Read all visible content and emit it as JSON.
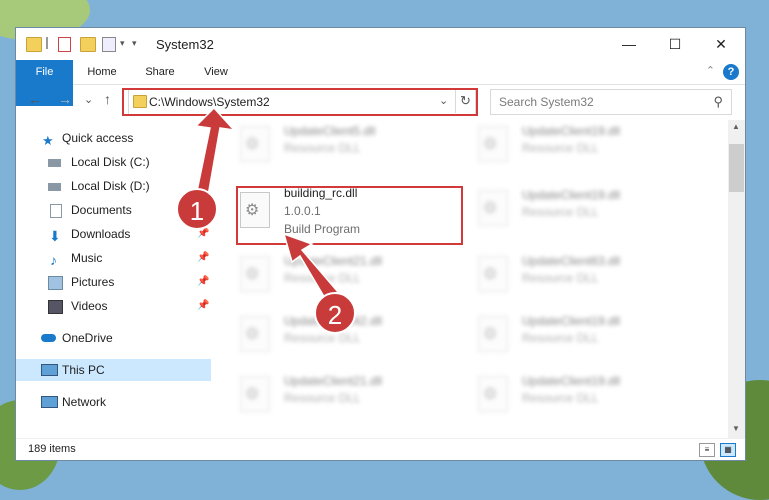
{
  "window": {
    "title": "System32",
    "controls": {
      "minimize": "—",
      "maximize": "☐",
      "close": "✕"
    }
  },
  "ribbon": {
    "tabs": [
      "File",
      "Home",
      "Share",
      "View"
    ],
    "help": "?",
    "collapse": "⌃"
  },
  "nav": {
    "back": "←",
    "forward": "→",
    "recent": "⌄",
    "up": "↑",
    "address": "C:\\Windows\\System32",
    "address_dropdown": "⌄",
    "refresh": "↻",
    "search_placeholder": "Search System32",
    "search_icon": "⚲"
  },
  "sidebar": {
    "items": [
      {
        "label": "Quick access",
        "icon": "star-icon"
      },
      {
        "label": "Local Disk (C:)",
        "icon": "drive-icon"
      },
      {
        "label": "Local Disk (D:)",
        "icon": "drive-icon"
      },
      {
        "label": "Documents",
        "icon": "documents-icon"
      },
      {
        "label": "Downloads",
        "icon": "download-icon"
      },
      {
        "label": "Music",
        "icon": "music-icon"
      },
      {
        "label": "Pictures",
        "icon": "pictures-icon"
      },
      {
        "label": "Videos",
        "icon": "videos-icon"
      },
      {
        "label": "OneDrive",
        "icon": "cloud-icon"
      },
      {
        "label": "This PC",
        "icon": "computer-icon"
      },
      {
        "label": "Network",
        "icon": "network-icon"
      }
    ],
    "pin": "📌"
  },
  "files": {
    "col1": [
      {
        "name": "UpdateClient5.dll",
        "desc": "Resource DLL"
      },
      {
        "name": "building_rc.dll",
        "version": "1.0.0.1",
        "desc": "Build Program"
      },
      {
        "name": "UpdateClient21.dll",
        "desc": "Resource DLL"
      },
      {
        "name": "UpdateClient42.dll",
        "desc": "Resource DLL"
      },
      {
        "name": "UpdateClient21.dll",
        "desc": "Resource DLL"
      }
    ],
    "col2": [
      {
        "name": "UpdateClient19.dll",
        "desc": "Resource DLL"
      },
      {
        "name": "UpdateClient19.dll",
        "desc": "Resource DLL"
      },
      {
        "name": "UpdateClient63.dll",
        "desc": "Resource DLL"
      },
      {
        "name": "UpdateClient19.dll",
        "desc": "Resource DLL"
      },
      {
        "name": "UpdateClient19.dll",
        "desc": "Resource DLL"
      }
    ]
  },
  "status": {
    "count": "189 items"
  },
  "annotations": {
    "step1": "1",
    "step2": "2"
  },
  "colors": {
    "accent": "#1979ca",
    "highlight": "#d23a3a",
    "selected": "#cce8ff"
  }
}
